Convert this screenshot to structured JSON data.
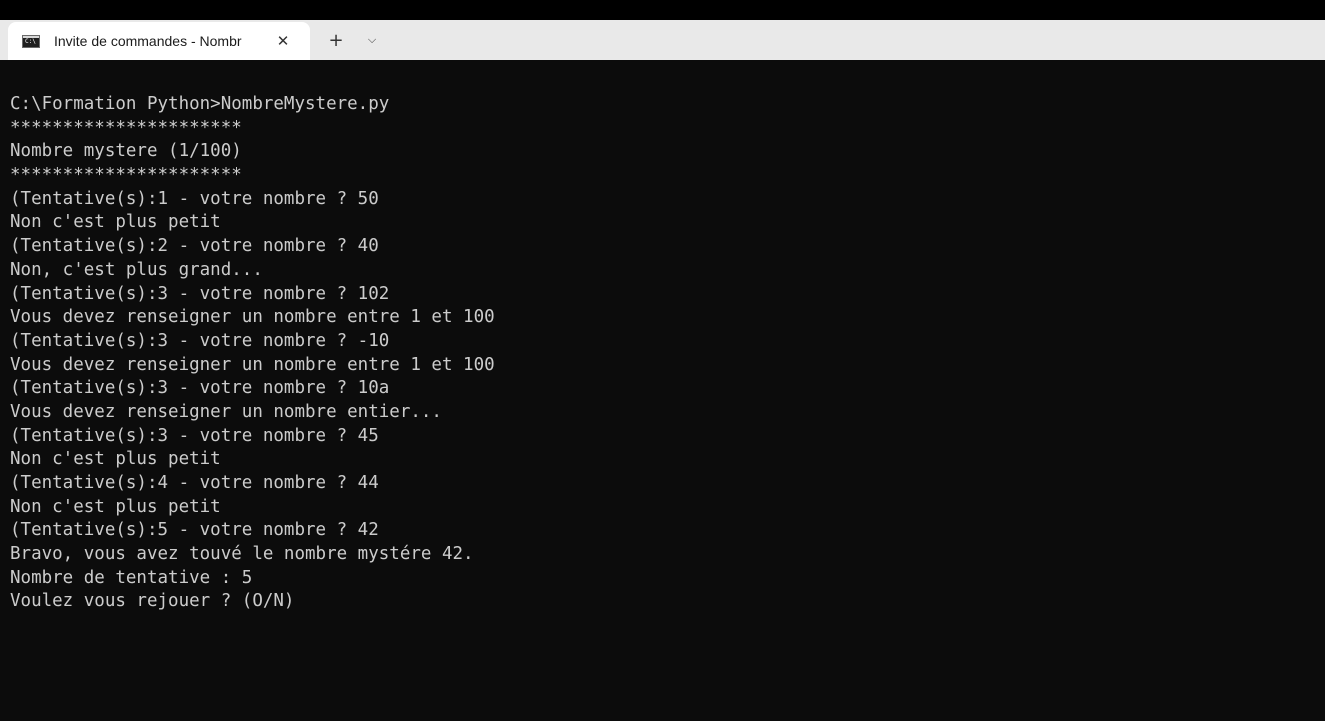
{
  "tab": {
    "icon": "cmd-icon",
    "title": "Invite de commandes - Nombr",
    "close_glyph": "✕",
    "new_tab_glyph": "+",
    "dropdown_glyph": "⌵"
  },
  "colors": {
    "console_bg": "#0c0c0c",
    "console_text": "#cccccc",
    "tabbar_bg": "#e9e9e9",
    "active_tab_bg": "#ffffff"
  },
  "console": {
    "lines": [
      "C:\\Formation Python>NombreMystere.py",
      "**********************",
      "Nombre mystere (1/100)",
      "**********************",
      "(Tentative(s):1 - votre nombre ? 50",
      "Non c'est plus petit",
      "(Tentative(s):2 - votre nombre ? 40",
      "Non, c'est plus grand...",
      "(Tentative(s):3 - votre nombre ? 102",
      "Vous devez renseigner un nombre entre 1 et 100",
      "(Tentative(s):3 - votre nombre ? -10",
      "Vous devez renseigner un nombre entre 1 et 100",
      "(Tentative(s):3 - votre nombre ? 10a",
      "Vous devez renseigner un nombre entier...",
      "(Tentative(s):3 - votre nombre ? 45",
      "Non c'est plus petit",
      "(Tentative(s):4 - votre nombre ? 44",
      "Non c'est plus petit",
      "(Tentative(s):5 - votre nombre ? 42",
      "Bravo, vous avez touvé le nombre mystére 42.",
      "Nombre de tentative : 5",
      "Voulez vous rejouer ? (O/N)"
    ]
  }
}
